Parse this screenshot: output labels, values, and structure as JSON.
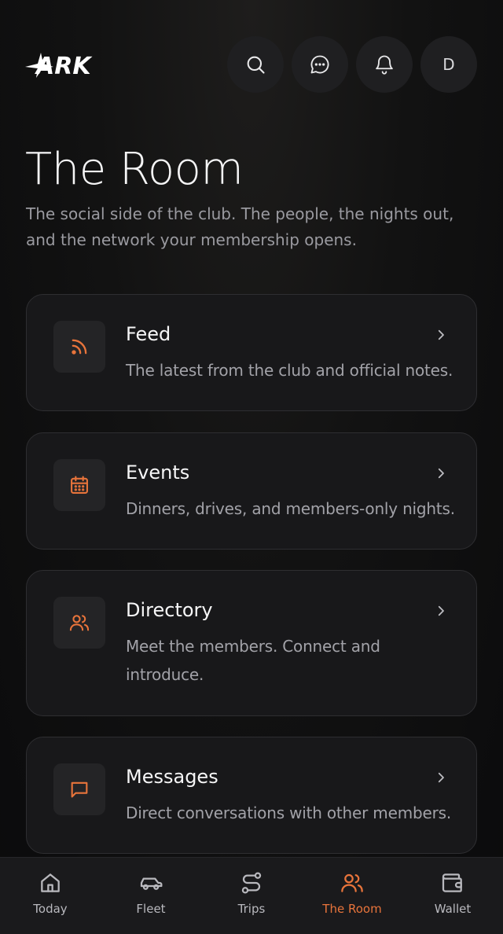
{
  "header": {
    "logo_text": "ARK",
    "search_icon": "search-icon",
    "messages_icon": "chat-bubble-icon",
    "notifications_icon": "bell-icon",
    "avatar_initial": "D"
  },
  "page": {
    "title": "The Room",
    "subtitle": "The social side of the club. The people, the nights out, and the network your membership opens."
  },
  "cards": [
    {
      "title": "Feed",
      "description": "The latest from the club and official notes.",
      "icon": "rss-icon"
    },
    {
      "title": "Events",
      "description": "Dinners, drives, and members-only nights.",
      "icon": "calendar-icon"
    },
    {
      "title": "Directory",
      "description": "Meet the members. Connect and introduce.",
      "icon": "users-icon"
    },
    {
      "title": "Messages",
      "description": "Direct conversations with other members.",
      "icon": "message-square-icon"
    }
  ],
  "nav": [
    {
      "label": "Today",
      "icon": "home-icon",
      "active": false
    },
    {
      "label": "Fleet",
      "icon": "car-icon",
      "active": false
    },
    {
      "label": "Trips",
      "icon": "route-icon",
      "active": false
    },
    {
      "label": "The Room",
      "icon": "users-icon",
      "active": true
    },
    {
      "label": "Wallet",
      "icon": "wallet-icon",
      "active": false
    }
  ],
  "colors": {
    "accent": "#e8743b",
    "background": "#0b0b0c",
    "card": "#18181a"
  }
}
